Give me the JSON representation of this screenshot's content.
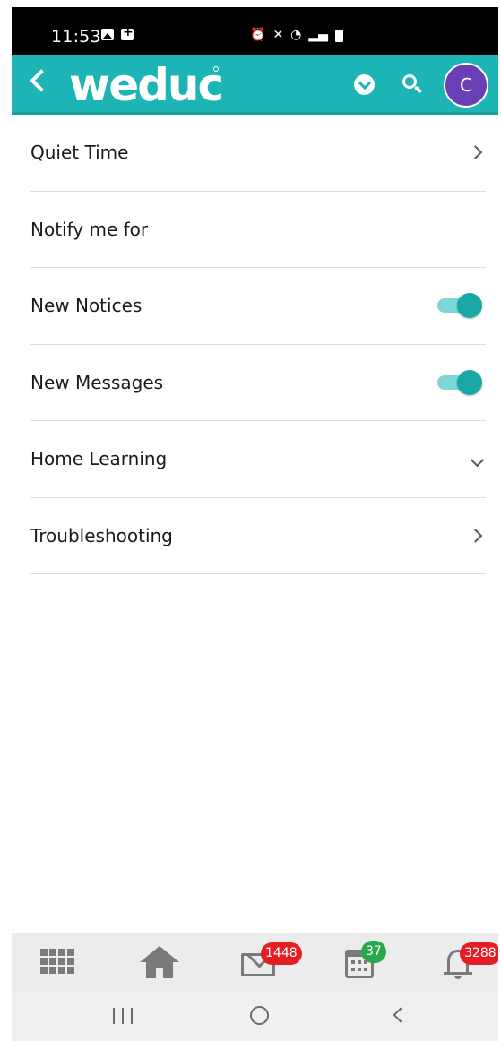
{
  "status_bar": {
    "time": "11:53"
  },
  "app_bar": {
    "logo": "weduc",
    "avatar_initial": "C",
    "accent_color": "#1cb4b4",
    "avatar_color": "#6a3fb5"
  },
  "settings": {
    "items": [
      {
        "label": "Quiet Time",
        "control": "chevron-right"
      },
      {
        "label": "Notify me for",
        "control": "none"
      },
      {
        "label": "New Notices",
        "control": "toggle",
        "on": true
      },
      {
        "label": "New Messages",
        "control": "toggle",
        "on": true
      },
      {
        "label": "Home Learning",
        "control": "chevron-down"
      },
      {
        "label": "Troubleshooting",
        "control": "chevron-right"
      }
    ]
  },
  "tab_bar": {
    "items": [
      {
        "icon": "grid-icon"
      },
      {
        "icon": "home-icon"
      },
      {
        "icon": "mail-icon",
        "badge": "1448",
        "badge_color": "#e51e26"
      },
      {
        "icon": "calendar-icon",
        "badge": "37",
        "badge_color": "#27a84a"
      },
      {
        "icon": "bell-icon",
        "badge": "3288",
        "badge_color": "#e51e26"
      }
    ]
  }
}
